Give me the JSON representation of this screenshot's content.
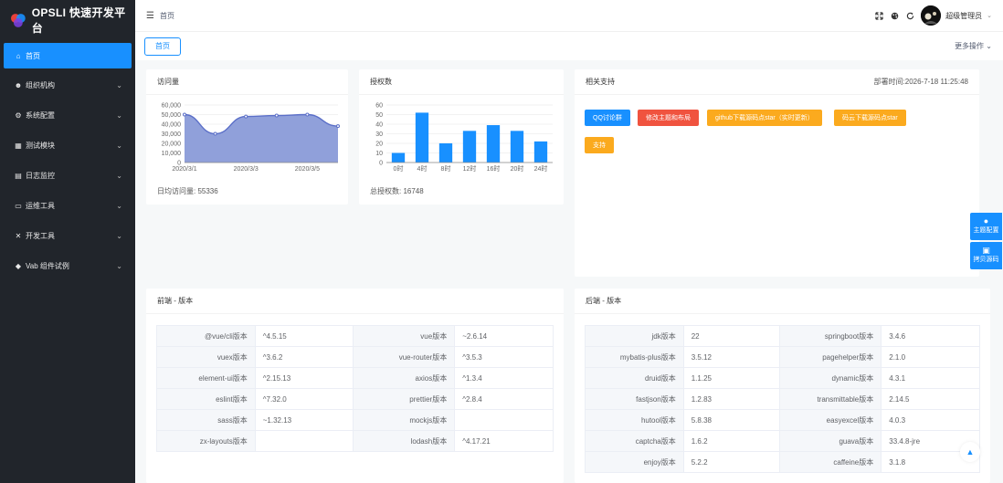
{
  "app": {
    "title": "OPSLI 快速开发平台"
  },
  "sidebar": {
    "items": [
      {
        "label": "首页",
        "icon": "home-icon",
        "active": true
      },
      {
        "label": "组织机构",
        "icon": "users-icon"
      },
      {
        "label": "系统配置",
        "icon": "gear-icon"
      },
      {
        "label": "测试模块",
        "icon": "box-icon"
      },
      {
        "label": "日志监控",
        "icon": "file-icon"
      },
      {
        "label": "运维工具",
        "icon": "monitor-icon"
      },
      {
        "label": "开发工具",
        "icon": "tools-icon"
      },
      {
        "label": "Vab 组件试例",
        "icon": "cubes-icon"
      }
    ]
  },
  "header": {
    "breadcrumb": "首页",
    "username": "超级管理员"
  },
  "tabs": {
    "items": [
      "首页"
    ],
    "more": "更多操作"
  },
  "visits": {
    "title": "访问量",
    "footer": "日均访问量: 55336",
    "chart_data": {
      "type": "area",
      "x": [
        "2020/3/1",
        "2020/3/2",
        "2020/3/3",
        "2020/3/4",
        "2020/3/5",
        "2020/3/6"
      ],
      "xtick_labels": [
        "2020/3/1",
        "2020/3/3",
        "2020/3/5"
      ],
      "values": [
        50000,
        30000,
        48000,
        49000,
        50000,
        38000
      ],
      "ylim": [
        0,
        60000
      ],
      "yticks": [
        "0",
        "10,000",
        "20,000",
        "30,000",
        "40,000",
        "50,000",
        "60,000"
      ],
      "color": "#5b6fc8",
      "fill": "#8a9bd8"
    }
  },
  "auth": {
    "title": "授权数",
    "footer": "总授权数: 16748",
    "chart_data": {
      "type": "bar",
      "categories": [
        "0时",
        "4时",
        "8时",
        "12时",
        "16时",
        "20时",
        "24时"
      ],
      "values": [
        10,
        52,
        20,
        33,
        39,
        33,
        22
      ],
      "ylim": [
        0,
        60
      ],
      "yticks": [
        "0",
        "10",
        "20",
        "30",
        "40",
        "50",
        "60"
      ],
      "color": "#1890ff"
    }
  },
  "support": {
    "title": "相关支持",
    "deploy": "部署时间:2026-7-18 11:25:48",
    "buttons": [
      {
        "label": "QQ讨论群",
        "color": "#1890ff"
      },
      {
        "label": "修改主题和布局",
        "color": "#f0533f"
      },
      {
        "label": "github下载源码点star（实时更新）",
        "color": "#fbaa1e"
      },
      {
        "label": "码云下载源码点star",
        "color": "#fbaa1e"
      },
      {
        "label": "支持",
        "color": "#fbaa1e"
      }
    ]
  },
  "frontend": {
    "title": "前端 - 版本",
    "rows": [
      [
        "@vue/cli版本",
        "^4.5.15",
        "vue版本",
        "~2.6.14"
      ],
      [
        "vuex版本",
        "^3.6.2",
        "vue-router版本",
        "^3.5.3"
      ],
      [
        "element-ui版本",
        "^2.15.13",
        "axios版本",
        "^1.3.4"
      ],
      [
        "eslint版本",
        "^7.32.0",
        "prettier版本",
        "^2.8.4"
      ],
      [
        "sass版本",
        "~1.32.13",
        "mockjs版本",
        ""
      ],
      [
        "zx-layouts版本",
        "",
        "lodash版本",
        "^4.17.21"
      ]
    ]
  },
  "backend": {
    "title": "后端 - 版本",
    "rows": [
      [
        "jdk版本",
        "22",
        "springboot版本",
        "3.4.6"
      ],
      [
        "mybatis-plus版本",
        "3.5.12",
        "pagehelper版本",
        "2.1.0"
      ],
      [
        "druid版本",
        "1.1.25",
        "dynamic版本",
        "4.3.1"
      ],
      [
        "fastjson版本",
        "1.2.83",
        "transmittable版本",
        "2.14.5"
      ],
      [
        "hutool版本",
        "5.8.38",
        "easyexcel版本",
        "4.0.3"
      ],
      [
        "captcha版本",
        "1.6.2",
        "guava版本",
        "33.4.8-jre"
      ],
      [
        "enjoy版本",
        "5.2.2",
        "caffeine版本",
        "3.1.8"
      ]
    ]
  },
  "side_tools": {
    "theme": "主题配置",
    "copy": "拷贝源码"
  }
}
